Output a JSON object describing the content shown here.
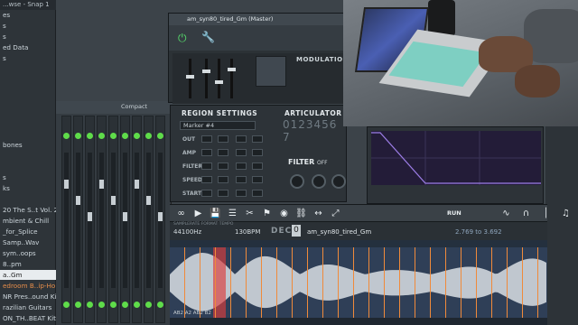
{
  "browser": {
    "title": "...wse - Snap 1",
    "items": [
      {
        "label": "es",
        "style": "normal"
      },
      {
        "label": "s",
        "style": "normal"
      },
      {
        "label": "s",
        "style": "normal"
      },
      {
        "label": "ed Data",
        "style": "normal"
      },
      {
        "label": "s",
        "style": "normal"
      },
      {
        "label": "",
        "style": "normal"
      },
      {
        "label": "",
        "style": "normal"
      },
      {
        "label": "",
        "style": "normal"
      },
      {
        "label": "",
        "style": "normal"
      },
      {
        "label": "",
        "style": "normal"
      },
      {
        "label": "",
        "style": "normal"
      },
      {
        "label": "",
        "style": "normal"
      },
      {
        "label": "bones",
        "style": "normal"
      },
      {
        "label": "",
        "style": "normal"
      },
      {
        "label": "",
        "style": "normal"
      },
      {
        "label": "s",
        "style": "normal"
      },
      {
        "label": "ks",
        "style": "normal"
      },
      {
        "label": "",
        "style": "normal"
      },
      {
        "label": "20 The S..t Vol. 2",
        "style": "normal"
      },
      {
        "label": "mbient & Chill",
        "style": "normal"
      },
      {
        "label": "_for_Splice",
        "style": "normal"
      },
      {
        "label": "Samp..Wav",
        "style": "normal"
      },
      {
        "label": "sym..oops",
        "style": "normal"
      },
      {
        "label": "8..pm",
        "style": "normal"
      },
      {
        "label": "a..Gm",
        "style": "selected"
      },
      {
        "label": "edroom B..ip-Hop",
        "style": "orange"
      },
      {
        "label": "NR Pres..ound Kit",
        "style": "normal"
      },
      {
        "label": "razilian Guitars",
        "style": "normal"
      },
      {
        "label": "ON_TH..BEAT Kit",
        "style": "normal"
      }
    ]
  },
  "mixer": {
    "compact_label": "Compact",
    "column_count": 9
  },
  "plugin": {
    "title": "am_syn80_tired_Gm (Master)",
    "modulation_label": "MODULATION",
    "icons": [
      "plug-icon",
      "wrench-icon"
    ]
  },
  "region": {
    "title": "REGION SETTINGS",
    "marker": "Marker #4",
    "articulator_label": "ARTICULATOR",
    "articulator_numbers": "0123456 7",
    "rows": [
      "OUT",
      "AMP",
      "FILTER",
      "SPEED",
      "START"
    ],
    "filter_label": "FILTER",
    "filter_state": "OFF"
  },
  "toolbar": {
    "buttons": [
      "loop-icon",
      "arrow-icon",
      "save-icon",
      "list-icon",
      "cut-icon",
      "tag-icon",
      "eye-icon",
      "link-icon",
      "chain-icon",
      "expand-icon",
      "sine-icon",
      "envelope-icon",
      "bars-icon",
      "tune-icon"
    ],
    "run_label": "RUN"
  },
  "deck": {
    "samplerate": "44100Hz",
    "tempo": "130BPM",
    "deck_label": "DECK",
    "deck_number": "0",
    "sample_name": "am_syn80_tired_Gm",
    "range": "2.769 to 3.692",
    "small_labels": "SAMPLERATE   FORMAT   TEMPO"
  },
  "wave": {
    "slice_tags": "AB2  A2   AB2  B2"
  },
  "colors": {
    "accent_green": "#55d86a",
    "slice_orange": "#f08a3a",
    "slice_red": "#dc3c3c",
    "wave_fill": "#d9dfe4"
  }
}
